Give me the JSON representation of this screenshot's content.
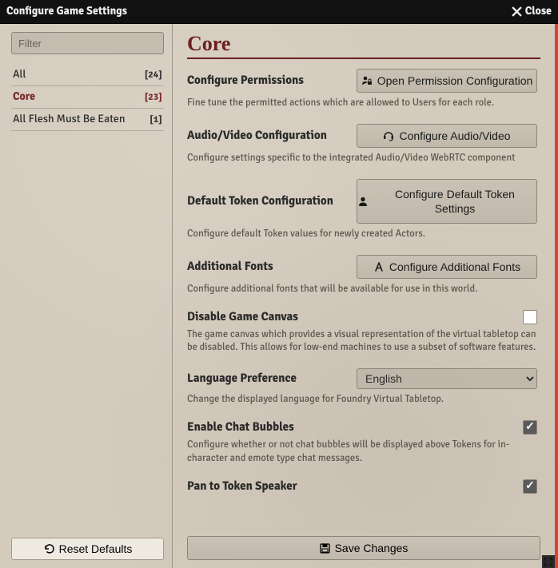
{
  "window": {
    "title": "Configure Game Settings",
    "close_label": "Close"
  },
  "sidebar": {
    "filter_placeholder": "Filter",
    "categories": [
      {
        "label": "All",
        "count": "[24]",
        "active": false
      },
      {
        "label": "Core",
        "count": "[23]",
        "active": true
      },
      {
        "label": "All Flesh Must Be Eaten",
        "count": "[1]",
        "active": false
      }
    ],
    "reset_label": "Reset Defaults"
  },
  "main": {
    "section_title": "Core",
    "save_label": "Save Changes",
    "settings": [
      {
        "id": "permissions",
        "label": "Configure Permissions",
        "hint": "Fine tune the permitted actions which are allowed to Users for each role.",
        "button": "Open Permission Configuration",
        "icon": "user-lock"
      },
      {
        "id": "av",
        "label": "Audio/Video Configuration",
        "hint": "Configure settings specific to the integrated Audio/Video WebRTC component",
        "button": "Configure Audio/Video",
        "icon": "headset"
      },
      {
        "id": "token",
        "label": "Default Token Configuration",
        "hint": "Configure default Token values for newly created Actors.",
        "button": "Configure Default Token Settings",
        "icon": "user",
        "tall": true
      },
      {
        "id": "fonts",
        "label": "Additional Fonts",
        "hint": "Configure additional fonts that will be available for use in this world.",
        "button": "Configure Additional Fonts",
        "icon": "font"
      },
      {
        "id": "disable-canvas",
        "label": "Disable Game Canvas",
        "hint": "The game canvas which provides a visual representation of the virtual tabletop can be disabled. This allows for low-end machines to use a subset of software features.",
        "type": "checkbox",
        "checked": false
      },
      {
        "id": "language",
        "label": "Language Preference",
        "hint": "Change the displayed language for Foundry Virtual Tabletop.",
        "type": "select",
        "value": "English"
      },
      {
        "id": "chat-bubbles",
        "label": "Enable Chat Bubbles",
        "hint": "Configure whether or not chat bubbles will be displayed above Tokens for in-character and emote type chat messages.",
        "type": "checkbox",
        "checked": true
      },
      {
        "id": "pan-token",
        "label": "Pan to Token Speaker",
        "hint": "",
        "type": "checkbox",
        "checked": true
      }
    ]
  }
}
